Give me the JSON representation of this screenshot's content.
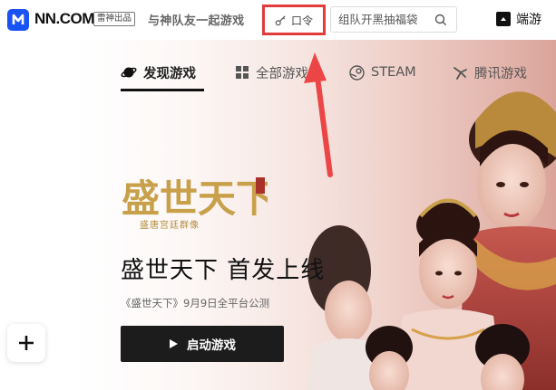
{
  "header": {
    "logo_text": "NN.COM",
    "badge": "雷神出品",
    "slogan": "与神队友一起游戏",
    "passcode_label": "口令",
    "search": {
      "placeholder": "组队开黑抽福袋"
    },
    "right_link": "端游"
  },
  "tabs": [
    {
      "label": "发现游戏",
      "icon": "planet-icon",
      "active": true
    },
    {
      "label": "全部游戏",
      "icon": "grid-icon",
      "active": false
    },
    {
      "label": "STEAM",
      "icon": "steam-icon",
      "active": false
    },
    {
      "label": "腾讯游戏",
      "icon": "tencent-icon",
      "active": false
    }
  ],
  "hero": {
    "title": "盛世天下 首发上线",
    "subtitle": "《盛世天下》9月9日全平台公测",
    "launch_label": "启动游戏",
    "logo_art": {
      "main": "盛世天下",
      "sub": "盛唐宫廷群像"
    }
  },
  "colors": {
    "accent_blue": "#1a53f5",
    "highlight_red": "#e33a3a",
    "dark_button": "#1c1c1c",
    "gold": "#c9a04a"
  }
}
